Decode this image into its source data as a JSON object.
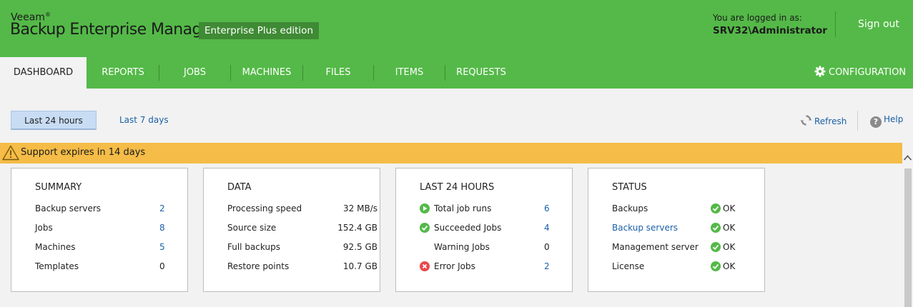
{
  "header": {
    "brand_small": "Veeam",
    "brand_mark": "®",
    "brand_title": "Backup Enterprise Manager",
    "edition": "Enterprise Plus edition",
    "login_label": "You are logged in as:",
    "login_user": "SRV32\\Administrator",
    "sign_out": "Sign out",
    "bg_color": "#54b948"
  },
  "nav": {
    "tabs": [
      {
        "label": "DASHBOARD",
        "active": true
      },
      {
        "label": "REPORTS"
      },
      {
        "label": "JOBS"
      },
      {
        "label": "MACHINES"
      },
      {
        "label": "FILES"
      },
      {
        "label": "ITEMS"
      },
      {
        "label": "REQUESTS"
      }
    ],
    "configuration": "CONFIGURATION"
  },
  "toolbar": {
    "period_selected": "Last 24 hours",
    "period_other": "Last 7 days",
    "refresh": "Refresh",
    "help": "Help"
  },
  "banner": {
    "text": "Support expires in 14 days",
    "color": "#f5bc47"
  },
  "summary": {
    "title": "SUMMARY",
    "rows": [
      {
        "label": "Backup servers",
        "value": "2"
      },
      {
        "label": "Jobs",
        "value": "8"
      },
      {
        "label": "Machines",
        "value": "5"
      },
      {
        "label": "Templates",
        "value": "0"
      }
    ]
  },
  "data_card": {
    "title": "DATA",
    "rows": [
      {
        "label": "Processing speed",
        "value": "32 MB/s"
      },
      {
        "label": "Source size",
        "value": "152.4 GB"
      },
      {
        "label": "Full backups",
        "value": "92.5 GB"
      },
      {
        "label": "Restore points",
        "value": "10.7 GB"
      }
    ]
  },
  "last24": {
    "title": "LAST 24 HOURS",
    "rows": [
      {
        "label": "Total job runs",
        "value": "6",
        "icon": "play-icon"
      },
      {
        "label": "Succeeded Jobs",
        "value": "4",
        "icon": "check-icon"
      },
      {
        "label": "Warning Jobs",
        "value": "0",
        "icon": ""
      },
      {
        "label": "Error Jobs",
        "value": "2",
        "icon": "error-icon"
      }
    ]
  },
  "status": {
    "title": "STATUS",
    "rows": [
      {
        "label": "Backups",
        "value": "OK"
      },
      {
        "label": "Backup servers",
        "value": "OK"
      },
      {
        "label": "Management server",
        "value": "OK"
      },
      {
        "label": "License",
        "value": "OK"
      }
    ]
  }
}
